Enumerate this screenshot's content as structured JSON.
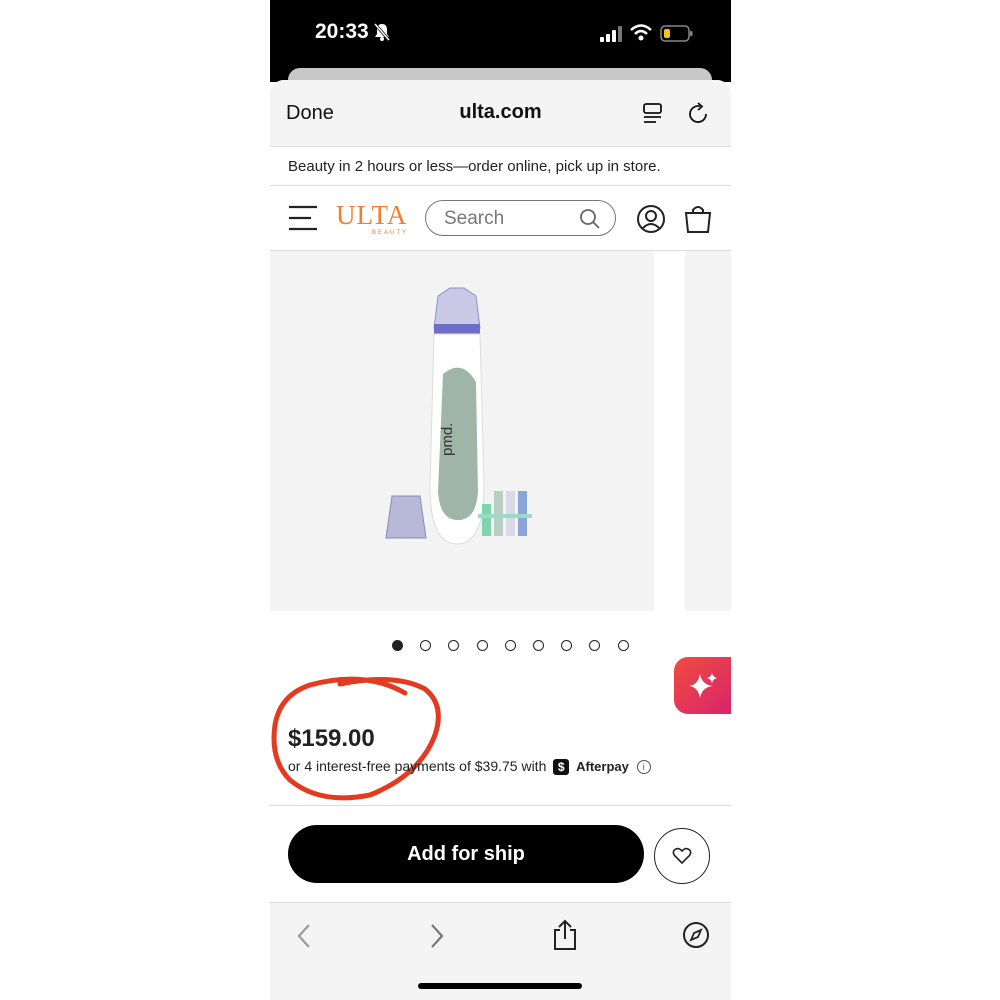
{
  "status_bar": {
    "time": "20:33"
  },
  "browser": {
    "done_label": "Done",
    "domain": "ulta.com"
  },
  "promo_banner": {
    "text": "Beauty in 2 hours or less—order online, pick up in store."
  },
  "header": {
    "logo_text": "ULTA",
    "logo_subtext": "BEAUTY",
    "search_placeholder": "Search",
    "brand_color": "#f47d2a"
  },
  "gallery": {
    "total_images": 9,
    "active_index": 0,
    "product_brand_text": "pmd."
  },
  "product": {
    "price": "$159.00",
    "installment_text": "or 4 interest-free payments of $39.75 with",
    "installment_icon": "$",
    "installment_provider": "Afterpay",
    "info_icon": "i"
  },
  "actions": {
    "add_button_label": "Add for ship"
  },
  "annotation": {
    "color": "#e23b1f"
  },
  "icons": {
    "menu": "hamburger-icon",
    "search": "search-icon",
    "account": "account-icon",
    "bag": "bag-icon",
    "ai": "sparkle-icon",
    "wishlist": "heart-icon",
    "back": "chevron-left-icon",
    "forward": "chevron-right-icon",
    "share": "share-icon",
    "compass": "compass-icon"
  }
}
